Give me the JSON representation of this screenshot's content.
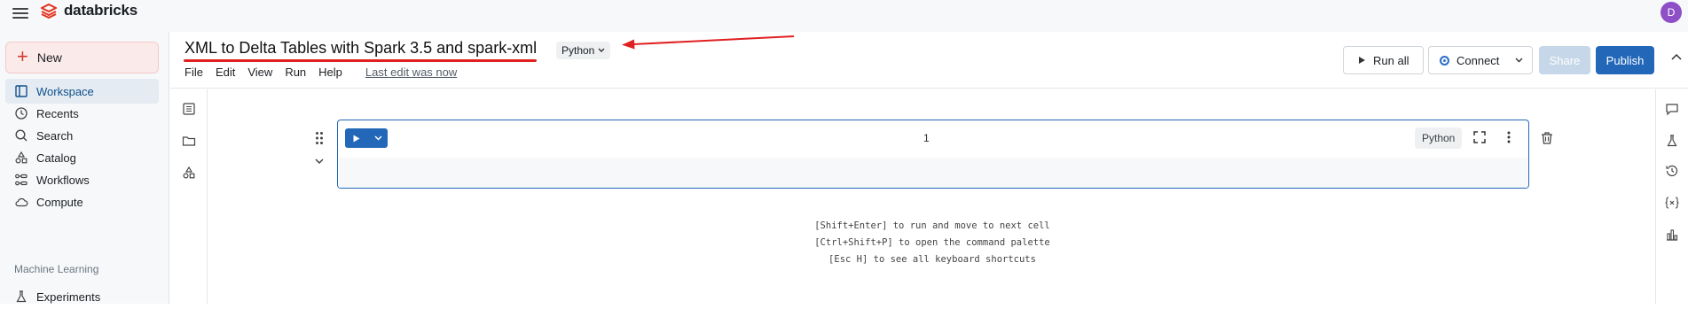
{
  "app": {
    "brand": "databricks",
    "avatar_initial": "D"
  },
  "sidebar": {
    "new_label": "New",
    "items": [
      {
        "label": "Workspace",
        "icon": "workspace-icon",
        "active": true
      },
      {
        "label": "Recents",
        "icon": "clock-icon"
      },
      {
        "label": "Search",
        "icon": "search-icon"
      },
      {
        "label": "Catalog",
        "icon": "catalog-icon"
      },
      {
        "label": "Workflows",
        "icon": "workflows-icon"
      },
      {
        "label": "Compute",
        "icon": "cloud-icon"
      }
    ],
    "section_header": "Machine Learning",
    "ml_items": [
      {
        "label": "Experiments",
        "icon": "experiments-icon"
      }
    ]
  },
  "notebook": {
    "title": "XML to Delta Tables with Spark 3.5 and spark-xml",
    "language": "Python",
    "menu": [
      "File",
      "Edit",
      "View",
      "Run",
      "Help"
    ],
    "last_edit": "Last edit was now",
    "run_all_label": "Run all",
    "connect_label": "Connect",
    "share_label": "Share",
    "publish_label": "Publish"
  },
  "cell": {
    "number": "1",
    "language": "Python"
  },
  "hints": [
    "[Shift+Enter] to run and move to next cell",
    "[Ctrl+Shift+P] to open the command palette",
    "[Esc H] to see all keyboard shortcuts"
  ],
  "colors": {
    "accent": "#2267b8",
    "brand_red": "#e02020",
    "annotation_red": "#e02020"
  }
}
